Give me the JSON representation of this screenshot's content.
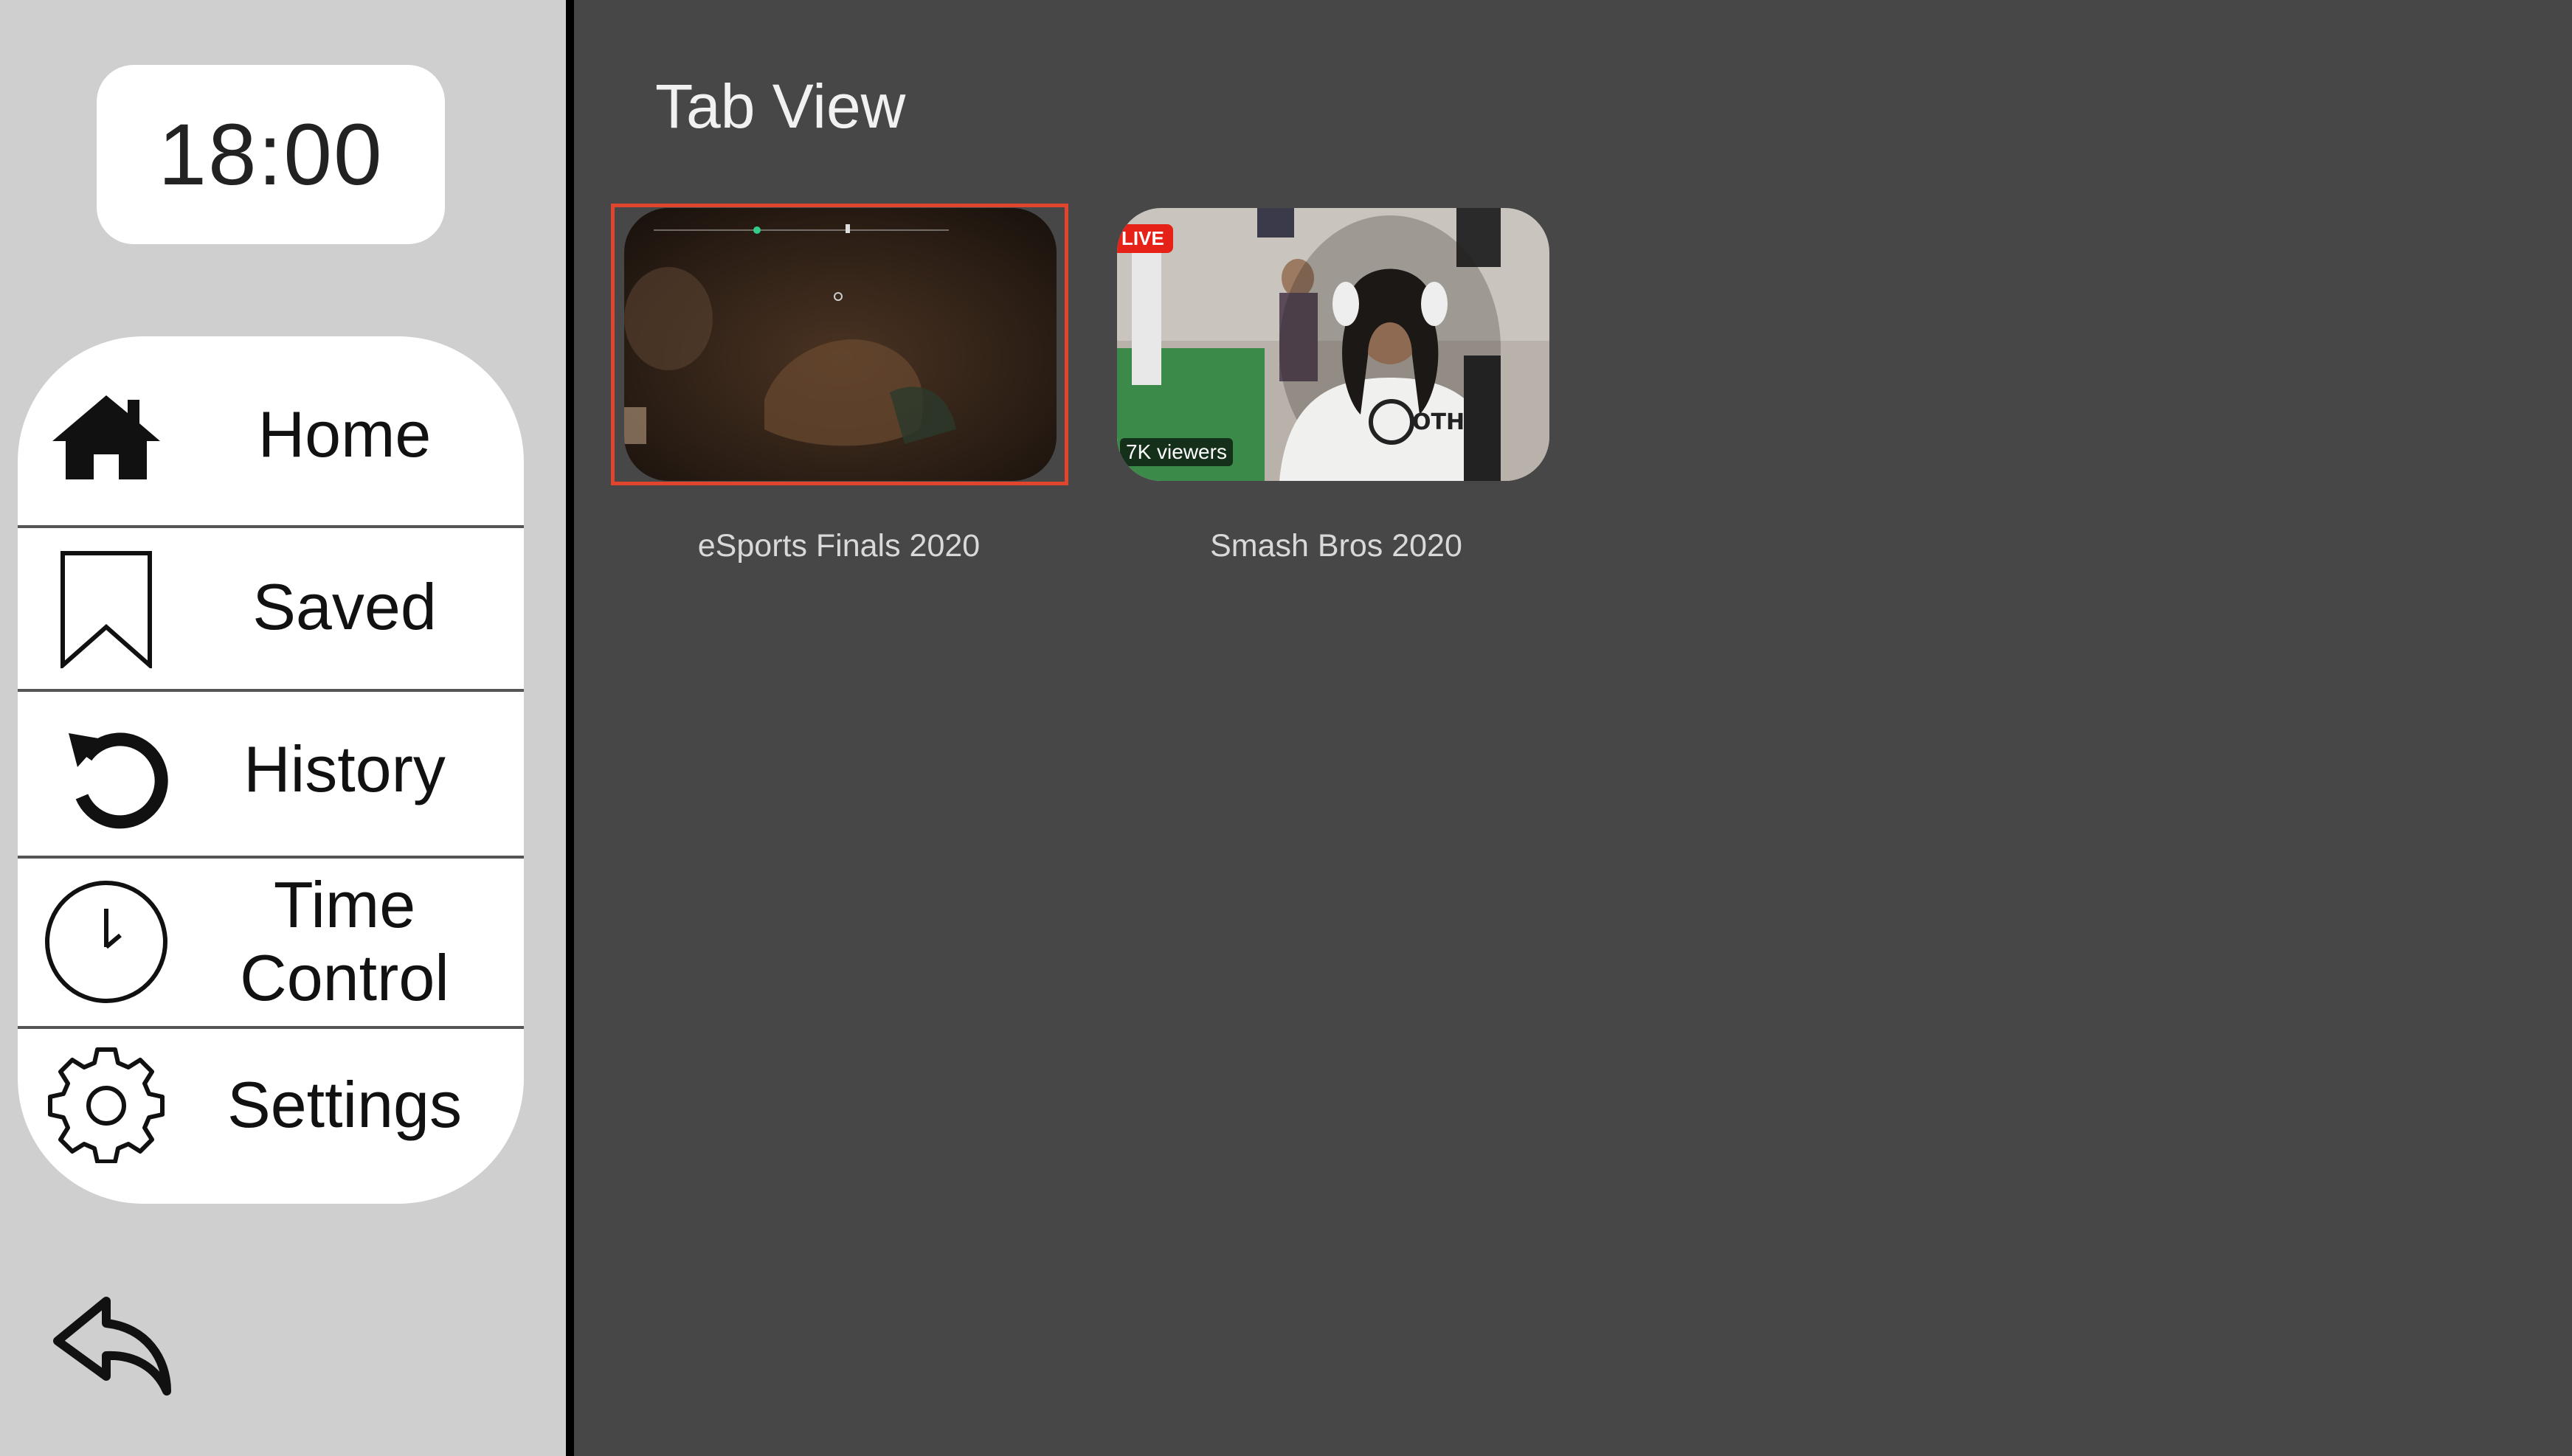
{
  "clock": {
    "time": "18:00"
  },
  "sidebar": {
    "items": [
      {
        "label": "Home",
        "icon": "home-icon"
      },
      {
        "label": "Saved",
        "icon": "bookmark-icon"
      },
      {
        "label": "History",
        "icon": "history-icon"
      },
      {
        "label": "Time\nControl",
        "icon": "clock-icon"
      },
      {
        "label": "Settings",
        "icon": "gear-icon"
      }
    ],
    "back_icon": "reply-back-icon"
  },
  "main": {
    "title": "Tab View",
    "cards": [
      {
        "title": "eSports Finals 2020",
        "selected": true
      },
      {
        "title": "Smash Bros 2020",
        "live_badge": "LIVE",
        "viewers": "7K viewers",
        "selected": false
      }
    ]
  },
  "colors": {
    "sidebar_bg": "#cfcfcf",
    "main_bg": "#474747",
    "focus_border": "#e0452e",
    "live_badge": "#e62117"
  }
}
